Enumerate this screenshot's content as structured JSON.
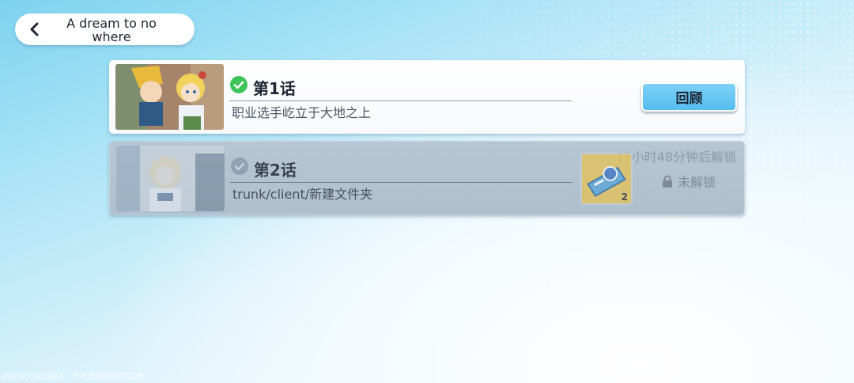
{
  "header": {
    "back_title": "A dream to no where"
  },
  "chapters": [
    {
      "title": "第1话",
      "subtitle": "职业选手屹立于大地之上",
      "status": "completed",
      "button_label": "回顾",
      "thumb_icon": "chapter-1-illustration"
    },
    {
      "title": "第2话",
      "subtitle": "trunk/client/新建文件夹",
      "status": "locked",
      "unlock_time": "13小时48分钟后解锁",
      "item_icon": "ticket-icon",
      "item_count": "2",
      "locked_label": "未解锁",
      "thumb_icon": "chapter-2-illustration"
    }
  ],
  "footer": {
    "note": "此版本为测试版本，不代表最终游戏品质"
  },
  "colors": {
    "accent": "#55bdf0",
    "check": "#3dc55a",
    "locked_card": "#b1c1d0"
  }
}
